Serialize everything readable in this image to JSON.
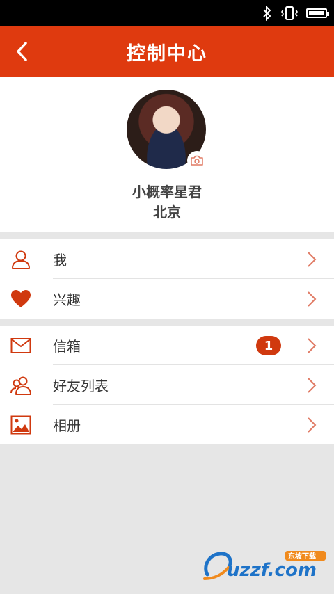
{
  "header": {
    "title": "控制中心",
    "back_icon": "chevron-left-icon",
    "color": "#df3a0f"
  },
  "status_bar": {
    "icons": [
      "bluetooth-icon",
      "vibrate-icon",
      "battery-icon"
    ]
  },
  "profile": {
    "name": "小概率星君",
    "city": "北京",
    "avatar_badge_icon": "camera-icon"
  },
  "menu": {
    "group1": [
      {
        "label": "我",
        "icon": "person-icon"
      },
      {
        "label": "兴趣",
        "icon": "heart-icon"
      }
    ],
    "group2": [
      {
        "label": "信箱",
        "icon": "mail-icon",
        "badge": "1"
      },
      {
        "label": "好友列表",
        "icon": "friends-icon"
      },
      {
        "label": "相册",
        "icon": "photo-album-icon"
      }
    ]
  },
  "watermark": {
    "text": "uzzf.com",
    "subtext": "东坡下载"
  },
  "colors": {
    "accent": "#df3a0f",
    "background": "#e6e6e6",
    "chevron": "#e07a64"
  }
}
